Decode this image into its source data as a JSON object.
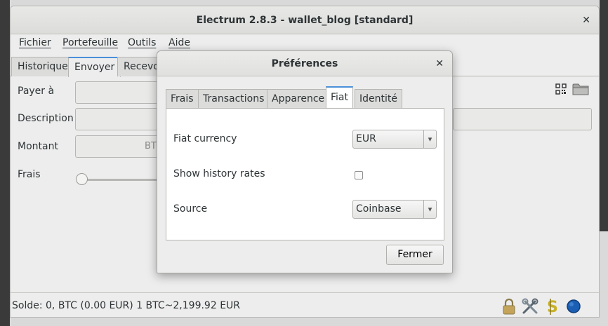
{
  "window": {
    "title": "Electrum 2.8.3  -  wallet_blog  [standard]",
    "close_symbol": "✕"
  },
  "menu": [
    "Fichier",
    "Portefeuille",
    "Outils",
    "Aide"
  ],
  "main_tabs": [
    "Historique",
    "Envoyer",
    "Recevoir"
  ],
  "main_tabs_active": "Envoyer",
  "send_form": {
    "pay_to_label": "Payer à",
    "description_label": "Description",
    "amount_label": "Montant",
    "amount_unit": "BTC",
    "fee_label": "Frais"
  },
  "status": {
    "text": "Solde: 0, BTC (0.00 EUR)  1 BTC~2,199.92 EUR",
    "icons": [
      "lock-icon",
      "tools-icon",
      "seed-icon",
      "network-status-icon"
    ]
  },
  "dialog": {
    "title": "Préférences",
    "close_symbol": "✕",
    "tabs": [
      "Frais",
      "Transactions",
      "Apparence",
      "Fiat",
      "Identité"
    ],
    "active_tab": "Fiat",
    "fiat_currency_label": "Fiat currency",
    "fiat_currency_value": "EUR",
    "history_rates_label": "Show history rates",
    "history_rates_checked": false,
    "source_label": "Source",
    "source_value": "Coinbase",
    "close_button": "Fermer"
  },
  "colors": {
    "accent": "#4a90d9",
    "window_bg": "#ededed",
    "status_dot": "#1a5fb4"
  }
}
